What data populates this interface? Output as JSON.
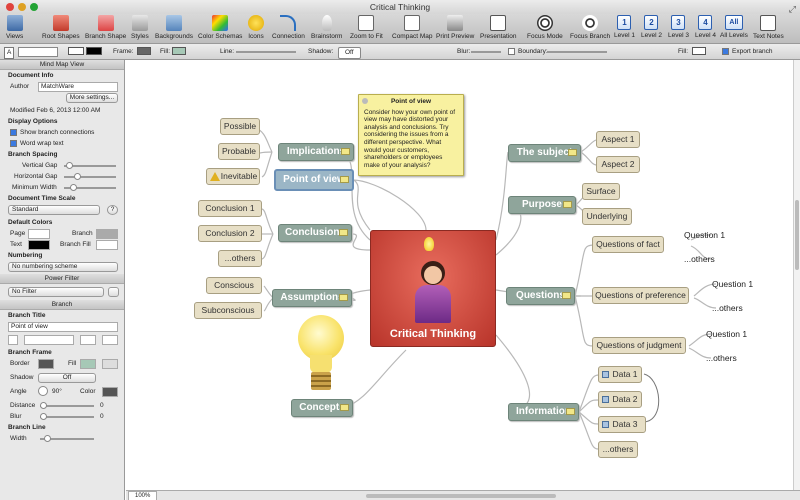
{
  "window": {
    "title": "Critical Thinking"
  },
  "toolbar": {
    "items": [
      "Views",
      "Root Shapes",
      "Branch Shape",
      "Styles",
      "Backgrounds",
      "Color Schemas",
      "Icons",
      "Connection",
      "Brainstorm",
      "Zoom to Fit",
      "Compact Map",
      "Print Preview",
      "Presentation",
      "Focus Mode",
      "Focus Branch",
      "Level 1",
      "Level 2",
      "Level 3",
      "Level 4",
      "All Levels",
      "Text Notes"
    ],
    "level_labels": [
      "1",
      "2",
      "3",
      "4",
      "All"
    ]
  },
  "formatbar": {
    "font_a": "A",
    "frame_label": "Frame:",
    "fill_label": "Fill:",
    "line_label": "Line:",
    "shadow_label": "Shadow:",
    "shadow_value": "Off",
    "blur_label": "Blur:",
    "boundary_label": "Boundary:",
    "fill2_label": "Fill:",
    "export_branch": "Export branch"
  },
  "sidebar": {
    "panel_title": "Mind Map View",
    "doc_info": "Document Info",
    "author_label": "Author",
    "author_value": "MatchWare",
    "more_settings": "More settings...",
    "modified_label": "Modified",
    "modified_value": "Feb 6, 2013 12:00 AM",
    "display_options": "Display Options",
    "show_branch": "Show branch connections",
    "word_wrap": "Word wrap text",
    "branch_spacing": "Branch Spacing",
    "vertical_gap": "Vertical Gap",
    "horizontal_gap": "Horizontal Gap",
    "minimum_width": "Minimum Width",
    "time_scale": "Document Time Scale",
    "time_scale_value": "Standard",
    "help": "?",
    "default_colors": "Default Colors",
    "page": "Page",
    "branch": "Branch",
    "text": "Text",
    "branch_fill": "Branch Fill",
    "numbering": "Numbering",
    "numbering_value": "No numbering scheme",
    "power_filter": "Power Filter",
    "filter_value": "No Filter",
    "branch_panel": "Branch",
    "branch_title": "Branch Title",
    "branch_title_value": "Point of view",
    "branch_frame": "Branch Frame",
    "border": "Border",
    "fill": "Fill",
    "shadow": "Shadow",
    "shadow_value": "Off",
    "angle": "Angle",
    "angle_value": "90°",
    "color": "Color",
    "distance": "Distance",
    "distance_value": "0",
    "blur": "Blur",
    "blur_value": "0",
    "branch_line": "Branch Line",
    "width": "Width"
  },
  "map": {
    "central": "Critical Thinking",
    "note": {
      "title": "Point of view",
      "body": "Consider how your own point of view may have distorted your analysis and conclusions. Try considering the issues from a different perspective.  What would your customers, shareholders or employees make of your analysis?"
    },
    "left": [
      {
        "label": "Implications",
        "children": [
          "Possible",
          "Probable",
          "Inevitable"
        ]
      },
      {
        "label": "Point of view",
        "children": []
      },
      {
        "label": "Conclusions",
        "children": [
          "Conclusion 1",
          "Conclusion 2",
          "...others"
        ]
      },
      {
        "label": "Assumptions",
        "children": [
          "Conscious",
          "Subconscious"
        ]
      },
      {
        "label": "Concepts",
        "children": []
      }
    ],
    "right": [
      {
        "label": "The subject",
        "children": [
          "Aspect 1",
          "Aspect 2"
        ]
      },
      {
        "label": "Purpose",
        "children": [
          "Surface",
          "Underlying"
        ]
      },
      {
        "label": "Questions",
        "children": [
          "Questions of fact",
          "Questions of preference",
          "Questions of judgment"
        ]
      },
      {
        "label": "Information",
        "children": [
          "Data 1",
          "Data 2",
          "Data 3",
          "...others"
        ]
      }
    ],
    "question_leaves": [
      "Question 1",
      "...others",
      "Question 1",
      "...others",
      "Question 1",
      "...others"
    ],
    "inevitable_icon": "warning-icon"
  },
  "statusbar": {
    "zoom": "100%"
  }
}
